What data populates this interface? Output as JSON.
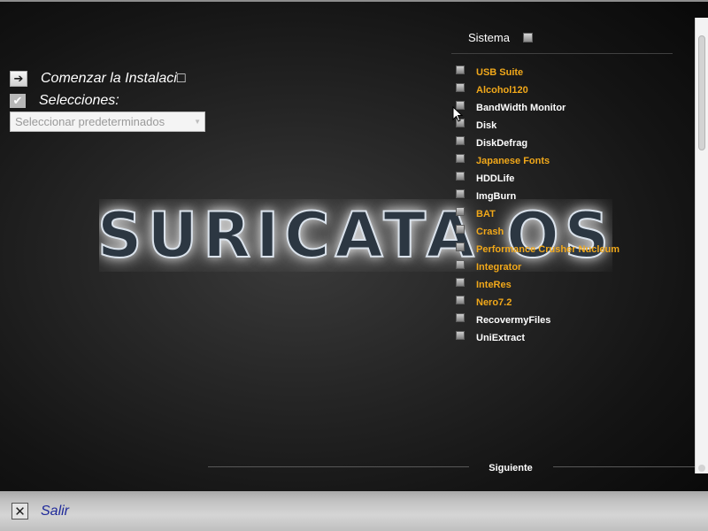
{
  "left_panel": {
    "install_label": "Comenzar la Instalaci□",
    "install_icon": "arrow-right-icon",
    "selections_label": "Selecciones:",
    "selections_icon": "checkmark-icon",
    "preset_dropdown": {
      "selected": "Seleccionar predeterminados"
    }
  },
  "logo": {
    "text": "SURICATA OS"
  },
  "right_panel": {
    "section_title": "Sistema",
    "items": [
      {
        "label": "USB Suite",
        "color": "#f1a81a"
      },
      {
        "label": "Alcohol120",
        "color": "#f1a81a"
      },
      {
        "label": "BandWidth Monitor",
        "color": "#ffffff"
      },
      {
        "label": "Disk",
        "color": "#ffffff"
      },
      {
        "label": "DiskDefrag",
        "color": "#ffffff"
      },
      {
        "label": "Japanese Fonts",
        "color": "#f1a81a"
      },
      {
        "label": "HDDLife",
        "color": "#ffffff"
      },
      {
        "label": "ImgBurn",
        "color": "#ffffff"
      },
      {
        "label": "BAT",
        "color": "#f1a81a"
      },
      {
        "label": "Crash",
        "color": "#f1a81a"
      },
      {
        "label": "Performance Crusher Nucleum",
        "color": "#f1a81a"
      },
      {
        "label": "Integrator",
        "color": "#f1a81a"
      },
      {
        "label": "InteRes",
        "color": "#f1a81a"
      },
      {
        "label": "Nero7.2",
        "color": "#f1a81a"
      },
      {
        "label": "RecovermyFiles",
        "color": "#ffffff"
      },
      {
        "label": "UniExtract",
        "color": "#ffffff"
      }
    ],
    "next_label": "Siguiente"
  },
  "bottom_bar": {
    "exit_label": "Salir",
    "exit_icon": "close-x-icon"
  },
  "colors": {
    "accent_orange": "#f1a81a",
    "text_white": "#ffffff",
    "exit_blue": "#1f2a9a"
  }
}
